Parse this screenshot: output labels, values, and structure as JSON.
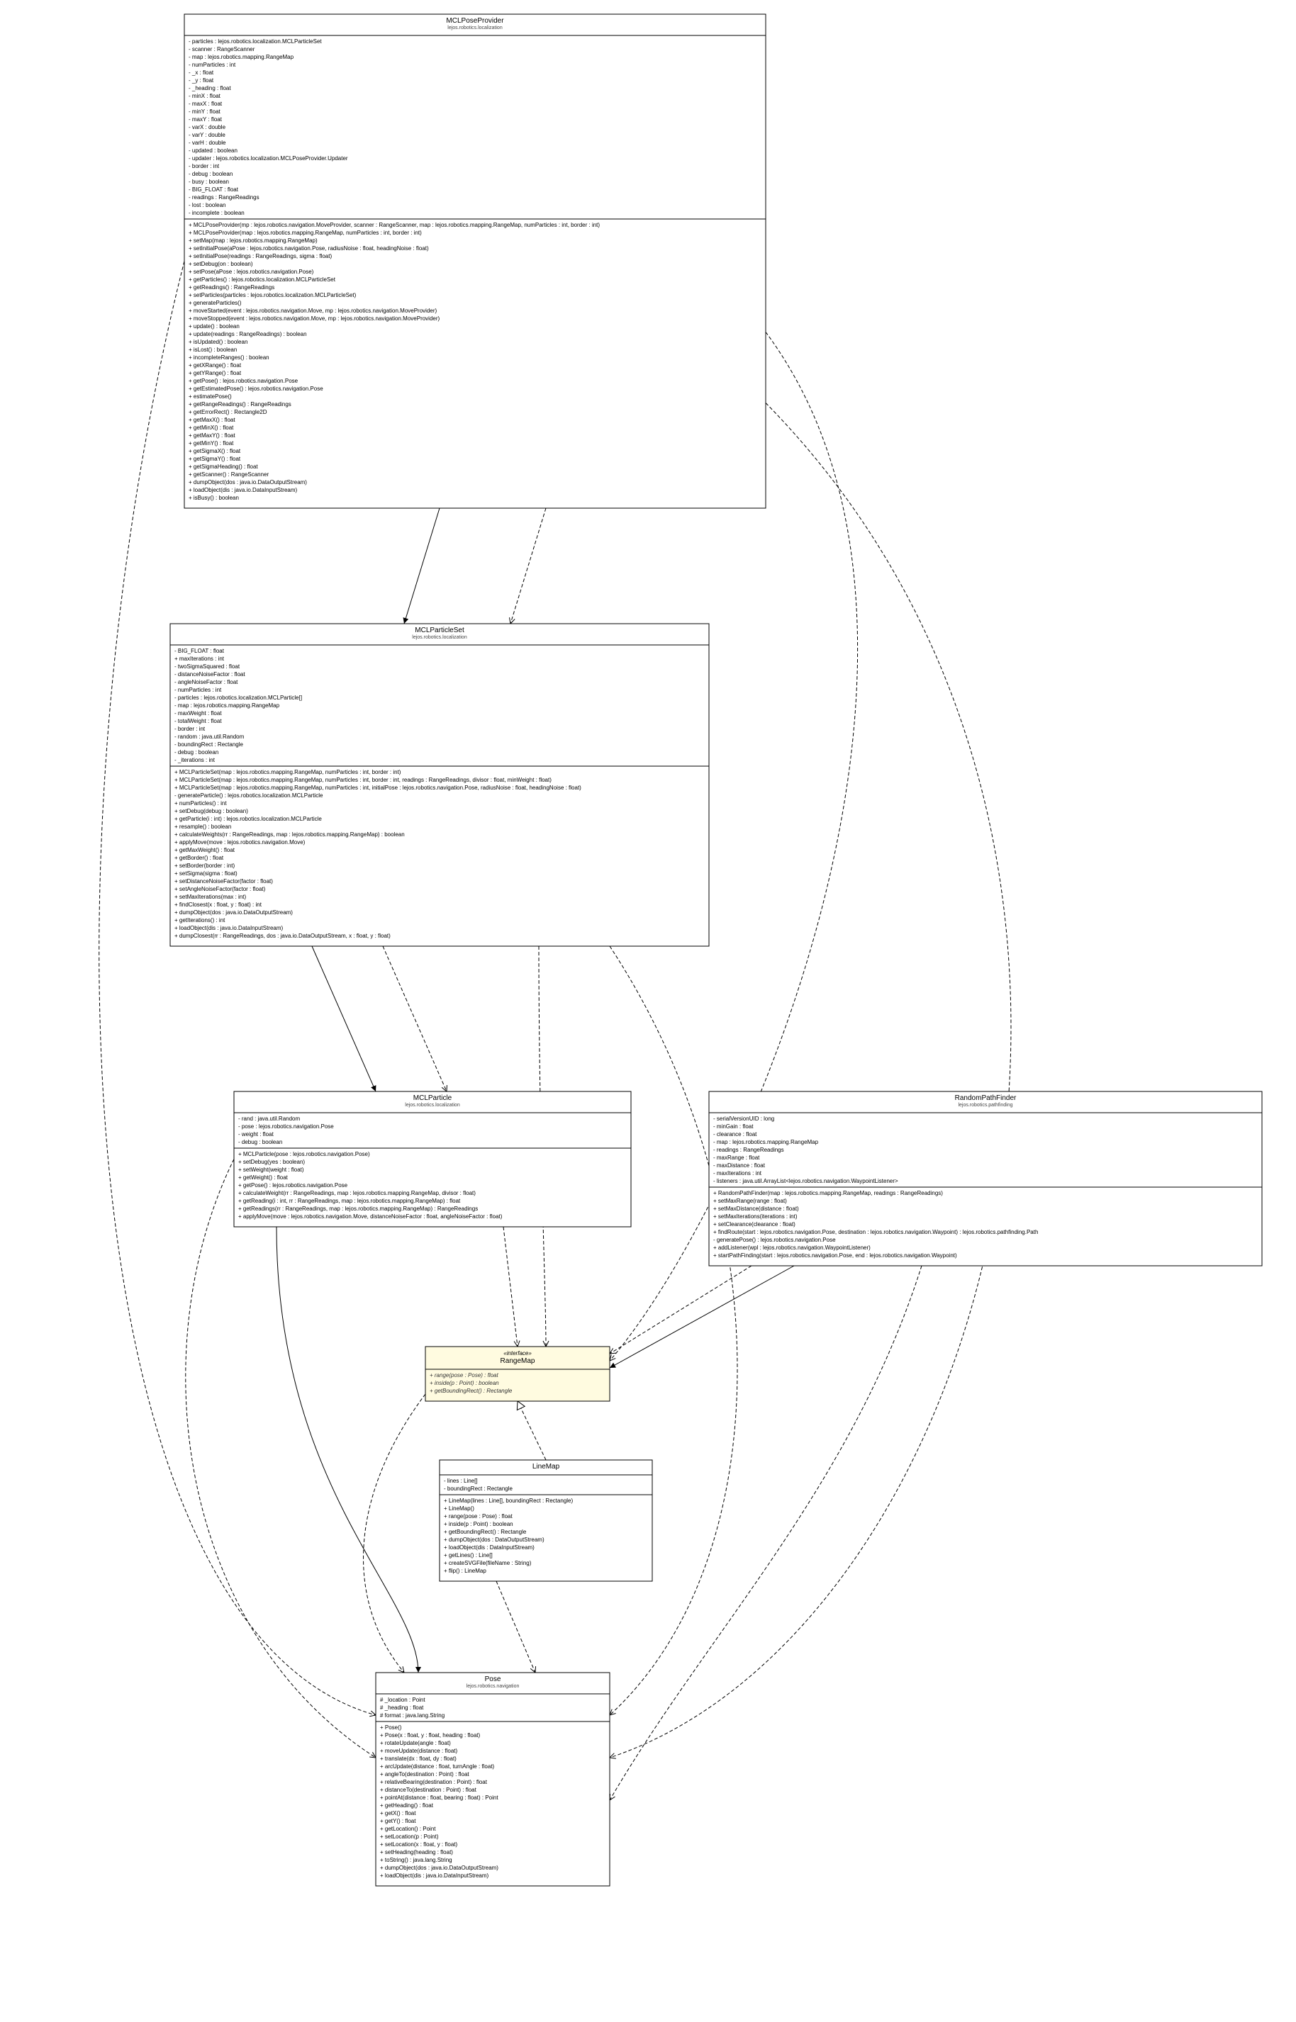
{
  "classes": {
    "mclpose": {
      "name": "MCLPoseProvider",
      "pkg": "lejos.robotics.localization",
      "fields": [
        "- particles : lejos.robotics.localization.MCLParticleSet",
        "- scanner : RangeScanner",
        "- map : lejos.robotics.mapping.RangeMap",
        "- numParticles : int",
        "- _x : float",
        "- _y : float",
        "- _heading : float",
        "- minX : float",
        "- maxX : float",
        "- minY : float",
        "- maxY : float",
        "- varX : double",
        "- varY : double",
        "- varH : double",
        "- updated : boolean",
        "- updater : lejos.robotics.localization.MCLPoseProvider.Updater",
        "- border : int",
        "- debug : boolean",
        "- busy : boolean",
        "- BIG_FLOAT : float",
        "- readings : RangeReadings",
        "- lost : boolean",
        "- incomplete : boolean"
      ],
      "methods": [
        "+ MCLPoseProvider(mp : lejos.robotics.navigation.MoveProvider, scanner : RangeScanner, map : lejos.robotics.mapping.RangeMap, numParticles : int, border : int)",
        "+ MCLPoseProvider(map : lejos.robotics.mapping.RangeMap, numParticles : int, border : int)",
        "+ setMap(map : lejos.robotics.mapping.RangeMap)",
        "+ setInitialPose(aPose : lejos.robotics.navigation.Pose, radiusNoise : float, headingNoise : float)",
        "+ setInitialPose(readings : RangeReadings, sigma : float)",
        "+ setDebug(on : boolean)",
        "+ setPose(aPose : lejos.robotics.navigation.Pose)",
        "+ getParticles() : lejos.robotics.localization.MCLParticleSet",
        "+ getReadings() : RangeReadings",
        "+ setParticles(particles : lejos.robotics.localization.MCLParticleSet)",
        "+ generateParticles()",
        "+ moveStarted(event : lejos.robotics.navigation.Move, mp : lejos.robotics.navigation.MoveProvider)",
        "+ moveStopped(event : lejos.robotics.navigation.Move, mp : lejos.robotics.navigation.MoveProvider)",
        "+ update() : boolean",
        "+ update(readings : RangeReadings) : boolean",
        "+ isUpdated() : boolean",
        "+ isLost() : boolean",
        "+ incompleteRanges() : boolean",
        "+ getXRange() : float",
        "+ getYRange() : float",
        "+ getPose() : lejos.robotics.navigation.Pose",
        "+ getEstimatedPose() : lejos.robotics.navigation.Pose",
        "+ estimatePose()",
        "+ getRangeReadings() : RangeReadings",
        "+ getErrorRect() : Rectangle2D",
        "+ getMaxX() : float",
        "+ getMinX() : float",
        "+ getMaxY() : float",
        "+ getMinY() : float",
        "+ getSigmaX() : float",
        "+ getSigmaY() : float",
        "+ getSigmaHeading() : float",
        "+ getScanner() : RangeScanner",
        "+ dumpObject(dos : java.io.DataOutputStream)",
        "+ loadObject(dis : java.io.DataInputStream)",
        "+ isBusy() : boolean"
      ]
    },
    "mclset": {
      "name": "MCLParticleSet",
      "pkg": "lejos.robotics.localization",
      "fields": [
        "- BIG_FLOAT : float",
        "+ maxIterations : int",
        "- twoSigmaSquared : float",
        "- distanceNoiseFactor : float",
        "- angleNoiseFactor : float",
        "- numParticles : int",
        "- particles : lejos.robotics.localization.MCLParticle[]",
        "- map : lejos.robotics.mapping.RangeMap",
        "- maxWeight : float",
        "- totalWeight : float",
        "- border : int",
        "- random : java.util.Random",
        "- boundingRect : Rectangle",
        "- debug : boolean",
        "- _iterations : int"
      ],
      "methods": [
        "+ MCLParticleSet(map : lejos.robotics.mapping.RangeMap, numParticles : int, border : int)",
        "+ MCLParticleSet(map : lejos.robotics.mapping.RangeMap, numParticles : int, border : int, readings : RangeReadings, divisor : float, minWeight : float)",
        "+ MCLParticleSet(map : lejos.robotics.mapping.RangeMap, numParticles : int, initialPose : lejos.robotics.navigation.Pose, radiusNoise : float, headingNoise : float)",
        "- generateParticle() : lejos.robotics.localization.MCLParticle",
        "+ numParticles() : int",
        "+ setDebug(debug : boolean)",
        "+ getParticle(i : int) : lejos.robotics.localization.MCLParticle",
        "+ resample() : boolean",
        "+ calculateWeights(rr : RangeReadings, map : lejos.robotics.mapping.RangeMap) : boolean",
        "+ applyMove(move : lejos.robotics.navigation.Move)",
        "+ getMaxWeight() : float",
        "+ getBorder() : float",
        "+ setBorder(border : int)",
        "+ setSigma(sigma : float)",
        "+ setDistanceNoiseFactor(factor : float)",
        "+ setAngleNoiseFactor(factor : float)",
        "+ setMaxIterations(max : int)",
        "+ findClosest(x : float, y : float) : int",
        "+ dumpObject(dos : java.io.DataOutputStream)",
        "+ getIterations() : int",
        "+ loadObject(dis : java.io.DataInputStream)",
        "+ dumpClosest(rr : RangeReadings, dos : java.io.DataOutputStream, x : float, y : float)"
      ]
    },
    "mclpart": {
      "name": "MCLParticle",
      "pkg": "lejos.robotics.localization",
      "fields": [
        "- rand : java.util.Random",
        "- pose : lejos.robotics.navigation.Pose",
        "- weight : float",
        "- debug : boolean"
      ],
      "methods": [
        "+ MCLParticle(pose : lejos.robotics.navigation.Pose)",
        "+ setDebug(yes : boolean)",
        "+ setWeight(weight : float)",
        "+ getWeight() : float",
        "+ getPose() : lejos.robotics.navigation.Pose",
        "+ calculateWeight(rr : RangeReadings, map : lejos.robotics.mapping.RangeMap, divisor : float)",
        "+ getReading(i : int, rr : RangeReadings, map : lejos.robotics.mapping.RangeMap) : float",
        "+ getReadings(rr : RangeReadings, map : lejos.robotics.mapping.RangeMap) : RangeReadings",
        "+ applyMove(move : lejos.robotics.navigation.Move, distanceNoiseFactor : float, angleNoiseFactor : float)"
      ]
    },
    "rpf": {
      "name": "RandomPathFinder",
      "pkg": "lejos.robotics.pathfinding",
      "fields": [
        "- serialVersionUID : long",
        "- minGain : float",
        "- clearance : float",
        "- map : lejos.robotics.mapping.RangeMap",
        "- readings : RangeReadings",
        "- maxRange : float",
        "- maxDistance : float",
        "- maxIterations : int",
        "- listeners : java.util.ArrayList<lejos.robotics.navigation.WaypointListener>"
      ],
      "methods": [
        "+ RandomPathFinder(map : lejos.robotics.mapping.RangeMap, readings : RangeReadings)",
        "+ setMaxRange(range : float)",
        "+ setMaxDistance(distance : float)",
        "+ setMaxIterations(iterations : int)",
        "+ setClearance(clearance : float)",
        "+ findRoute(start : lejos.robotics.navigation.Pose, destination : lejos.robotics.navigation.Waypoint) : lejos.robotics.pathfinding.Path",
        "- generatePose() : lejos.robotics.navigation.Pose",
        "+ addListener(wpl : lejos.robotics.navigation.WaypointListener)",
        "+ startPathFinding(start : lejos.robotics.navigation.Pose, end : lejos.robotics.navigation.Waypoint)"
      ]
    },
    "rmap": {
      "name": "RangeMap",
      "ster": "«interface»",
      "methods": [
        "+ range(pose : Pose) : float",
        "+ inside(p : Point) : boolean",
        "+ getBoundingRect() : Rectangle"
      ]
    },
    "lmap": {
      "name": "LineMap",
      "fields": [
        "- lines : Line[]",
        "- boundingRect : Rectangle"
      ],
      "methods": [
        "+ LineMap(lines : Line[], boundingRect : Rectangle)",
        "+ LineMap()",
        "+ range(pose : Pose) : float",
        "+ inside(p : Point) : boolean",
        "+ getBoundingRect() : Rectangle",
        "+ dumpObject(dos : DataOutputStream)",
        "+ loadObject(dis : DataInputStream)",
        "+ getLines() : Line[]",
        "+ createSVGFile(fileName : String)",
        "+ flip() : LineMap"
      ]
    },
    "pose": {
      "name": "Pose",
      "pkg": "lejos.robotics.navigation",
      "fields": [
        "# _location : Point",
        "# _heading : float",
        "# format : java.lang.String"
      ],
      "methods": [
        "+ Pose()",
        "+ Pose(x : float, y : float, heading : float)",
        "+ rotateUpdate(angle : float)",
        "+ moveUpdate(distance : float)",
        "+ translate(dx : float, dy : float)",
        "+ arcUpdate(distance : float, turnAngle : float)",
        "+ angleTo(destination : Point) : float",
        "+ relativeBearing(destination : Point) : float",
        "+ distanceTo(destination : Point) : float",
        "+ pointAt(distance : float, bearing : float) : Point",
        "+ getHeading() : float",
        "+ getX() : float",
        "+ getY() : float",
        "+ getLocation() : Point",
        "+ setLocation(p : Point)",
        "+ setLocation(x : float, y : float)",
        "+ setHeading(heading : float)",
        "+ toString() : java.lang.String",
        "+ dumpObject(dos : java.io.DataOutputStream)",
        "+ loadObject(dis : java.io.DataInputStream)"
      ]
    }
  }
}
